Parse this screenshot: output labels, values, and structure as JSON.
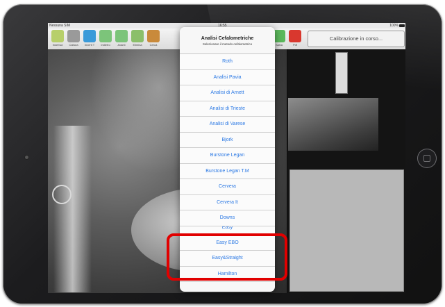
{
  "status_bar": {
    "carrier": "Nessuna SIM",
    "time": "16:55",
    "battery": "100%"
  },
  "toolbar": {
    "tools": [
      {
        "label": "Inserisci",
        "icon": "add-image-icon",
        "color": "#b7cf6a"
      },
      {
        "label": "Cattura",
        "icon": "crop-icon",
        "color": "#8a8a8a"
      },
      {
        "label": "Inverti T",
        "icon": "invert-icon",
        "color": "#3a9ad9"
      },
      {
        "label": "Indietro",
        "icon": "undo-icon",
        "color": "#5cb85c"
      },
      {
        "label": "Avanti",
        "icon": "redo-icon",
        "color": "#5cb85c"
      },
      {
        "label": "Elimina",
        "icon": "delete-icon",
        "color": "#6ab04c"
      },
      {
        "label": "Cerca",
        "icon": "search-icon",
        "color": "#c98a3b"
      }
    ],
    "right_tools": [
      {
        "label": "Salva",
        "icon": "check-icon",
        "color": "#5cb85c"
      },
      {
        "label": "Pdf",
        "icon": "pdf-icon",
        "color": "#d9382e"
      }
    ],
    "calibration_label": "Calibrazione in corso..."
  },
  "popover": {
    "title": "Analisi Cefalometriche",
    "subtitle": "Selezionare il metodo cefalometrico",
    "items": [
      "Roth",
      "Analisi Pavia",
      "Analisi di Arnett",
      "Analisi di Trieste",
      "Analisi di Varese",
      "Bjork",
      "Burstone Legan",
      "Burstone Legan T.M",
      "Cervera",
      "Cervera It",
      "Downs",
      "Easy",
      "Easy EBO",
      "Easy&Straight",
      "Hamilton"
    ]
  },
  "colors": {
    "accent": "#2a78e4",
    "highlight": "#e10000"
  }
}
